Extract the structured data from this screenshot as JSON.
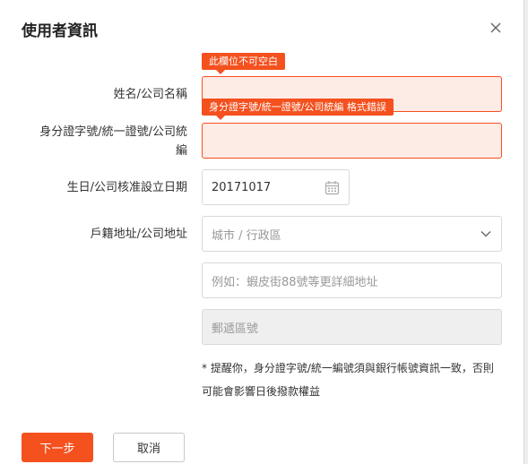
{
  "dialog": {
    "title": "使用者資訊",
    "close_icon": "close-icon"
  },
  "form": {
    "name_label": "姓名/公司名稱",
    "name_error": "此欄位不可空白",
    "name_value": "",
    "id_label_line1": "身分證字號/統一證號/公司統",
    "id_label_line2": "編",
    "id_error": "身分證字號/統一證號/公司統編 格式錯誤",
    "id_value": "",
    "date_label": "生日/公司核准設立日期",
    "date_value": "20171017",
    "date_icon": "calendar-icon",
    "address_label": "戶籍地址/公司地址",
    "city_placeholder": "城市 / 行政區",
    "dropdown_icon": "chevron-down-icon",
    "street_placeholder": "例如：蝦皮街88號等更詳細地址",
    "postal_placeholder": "郵遞區號",
    "note": "* 提醒你，身分證字號/統一編號須與銀行帳號資訊一致，否則可能會影響日後撥款權益"
  },
  "buttons": {
    "next_label": "下一步",
    "cancel_label": "取消"
  },
  "colors": {
    "accent": "#f4511e",
    "error_bg": "#fdebe6"
  }
}
